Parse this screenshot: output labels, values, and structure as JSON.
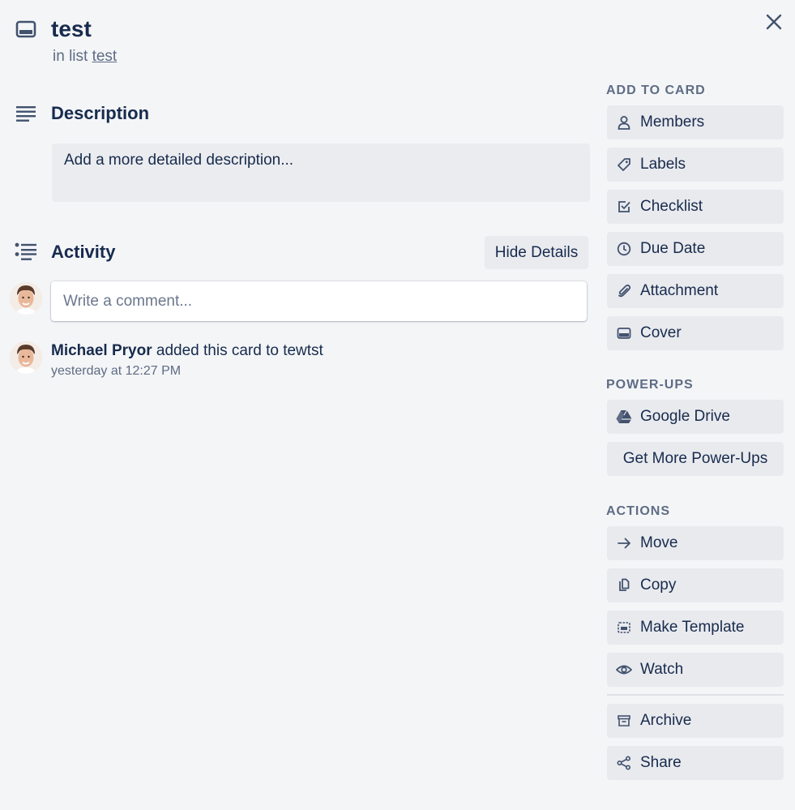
{
  "card": {
    "title": "test",
    "in_list_prefix": "in list",
    "list_name": "test"
  },
  "description": {
    "heading": "Description",
    "placeholder": "Add a more detailed description..."
  },
  "activity": {
    "heading": "Activity",
    "toggle_details_label": "Hide Details",
    "comment_placeholder": "Write a comment...",
    "entries": [
      {
        "user": "Michael Pryor",
        "action": "added this card to tewtst",
        "time": "yesterday at 12:27 PM"
      }
    ]
  },
  "sidebar": {
    "add_to_card": {
      "heading": "ADD TO CARD",
      "buttons": [
        {
          "label": "Members",
          "icon": "person-icon"
        },
        {
          "label": "Labels",
          "icon": "tag-icon"
        },
        {
          "label": "Checklist",
          "icon": "checkbox-icon"
        },
        {
          "label": "Due Date",
          "icon": "clock-icon"
        },
        {
          "label": "Attachment",
          "icon": "paperclip-icon"
        },
        {
          "label": "Cover",
          "icon": "card-cover-icon"
        }
      ]
    },
    "power_ups": {
      "heading": "POWER-UPS",
      "buttons": [
        {
          "label": "Google Drive",
          "icon": "google-drive-icon"
        },
        {
          "label": "Get More Power-Ups"
        }
      ]
    },
    "actions": {
      "heading": "ACTIONS",
      "buttons": [
        {
          "label": "Move",
          "icon": "arrow-right-icon"
        },
        {
          "label": "Copy",
          "icon": "copy-icon"
        },
        {
          "label": "Make Template",
          "icon": "template-icon"
        },
        {
          "label": "Watch",
          "icon": "eye-icon"
        },
        {
          "label": "Archive",
          "icon": "archive-icon"
        },
        {
          "label": "Share",
          "icon": "share-icon"
        }
      ]
    }
  },
  "colors": {
    "background": "#f4f5f7",
    "text": "#172b4d",
    "muted": "#5e6c84",
    "button_bg": "#e9eaee"
  }
}
